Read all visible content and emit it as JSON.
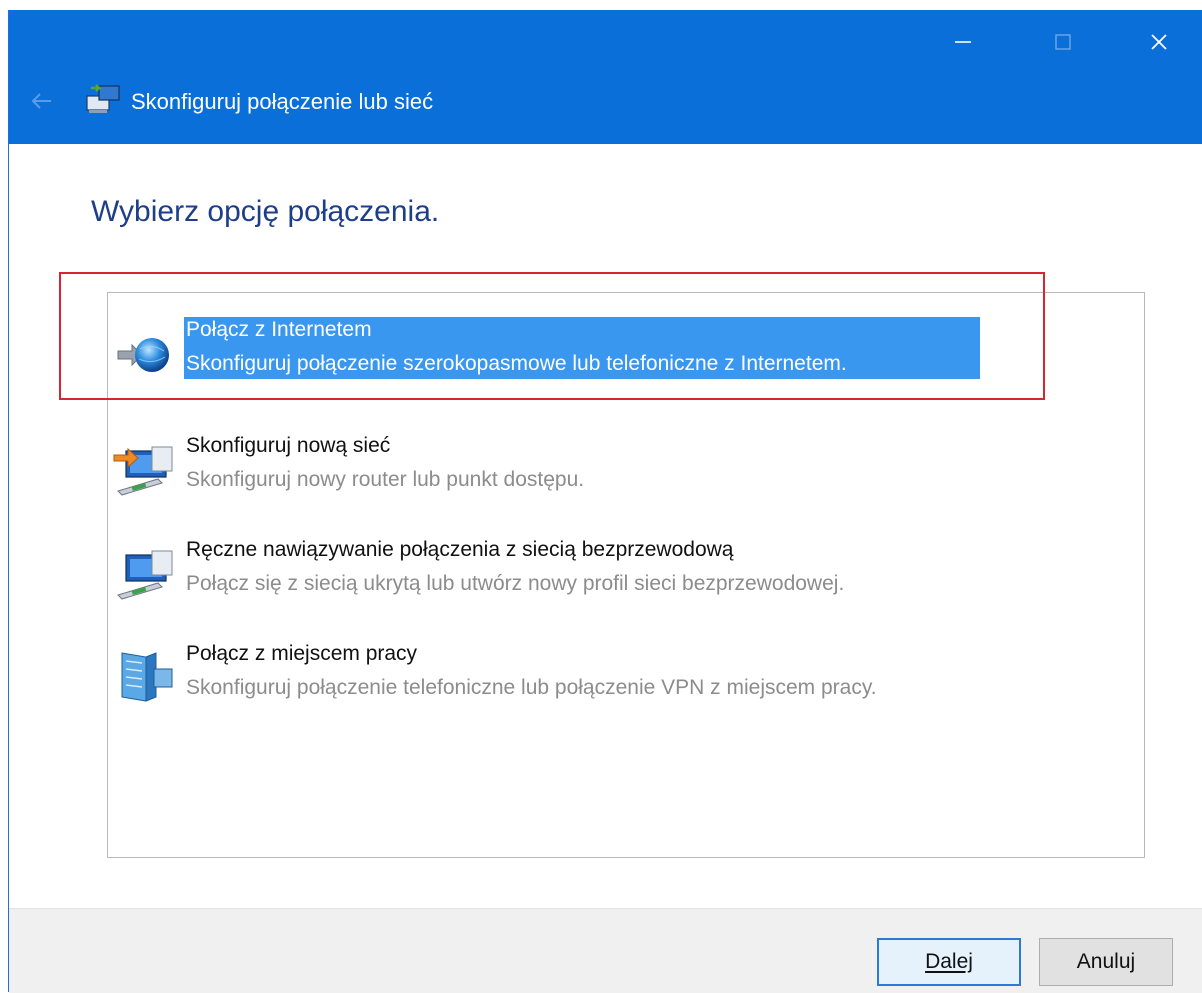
{
  "window": {
    "title": "Skonfiguruj połączenie lub sieć",
    "controls": {
      "minimize": "minimize",
      "maximize": "maximize",
      "close": "close"
    }
  },
  "main": {
    "heading": "Wybierz opcję połączenia.",
    "options": [
      {
        "title": "Połącz z Internetem",
        "description": "Skonfiguruj połączenie szerokopasmowe lub telefoniczne z Internetem.",
        "icon": "globe-arrow-icon",
        "selected": true
      },
      {
        "title": "Skonfiguruj nową sieć",
        "description": "Skonfiguruj nowy router lub punkt dostępu.",
        "icon": "network-setup-icon",
        "selected": false
      },
      {
        "title": "Ręczne nawiązywanie połączenia z siecią bezprzewodową",
        "description": "Połącz się z siecią ukrytą lub utwórz nowy profil sieci bezprzewodowej.",
        "icon": "wireless-network-icon",
        "selected": false
      },
      {
        "title": "Połącz z miejscem pracy",
        "description": "Skonfiguruj połączenie telefoniczne lub połączenie VPN z miejscem pracy.",
        "icon": "workplace-building-icon",
        "selected": false
      }
    ]
  },
  "footer": {
    "next_label": "Dalej",
    "cancel_label": "Anuluj"
  },
  "colors": {
    "titlebar": "#0a6fd8",
    "heading": "#1e3e8a",
    "selection": "#3a97f0",
    "highlight_frame": "#d9232e"
  }
}
